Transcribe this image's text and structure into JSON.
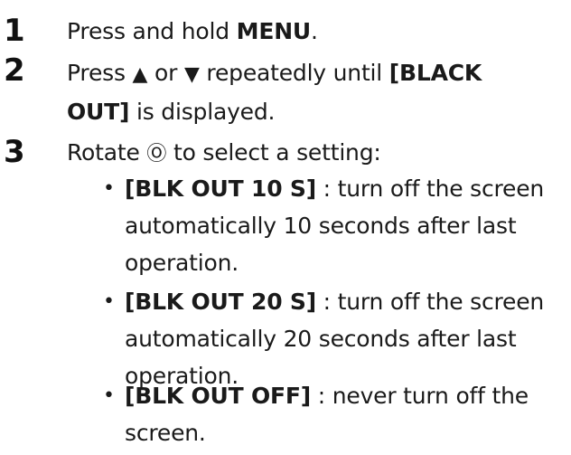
{
  "steps": [
    {
      "number": "1",
      "text_before": "Press and hold ",
      "bold": "MENU",
      "text_after": "."
    },
    {
      "number": "2",
      "line1_text": "Press ",
      "up_symbol": "▲",
      "or_text": " or ",
      "down_symbol": "▼",
      "line1_rest": " repeatedly until ",
      "bold_part1": "[BLACK",
      "bold_part2": "OUT]",
      "line2_rest": " is displayed."
    },
    {
      "number": "3",
      "text_before": "Rotate ",
      "knob_symbol": "Ⓞ",
      "text_after": " to select a setting:"
    }
  ],
  "bullets": [
    {
      "marker": "•",
      "label": "[BLK OUT 10 S]",
      "line1": " : turn off the screen",
      "line2": "automatically 10 seconds after last",
      "line3": "operation."
    },
    {
      "marker": "•",
      "label": "[BLK OUT 20 S]",
      "line1": " : turn off the screen",
      "line2": "automatically 20 seconds after last",
      "line3": "operation."
    },
    {
      "marker": "•",
      "label": "[BLK OUT OFF]",
      "line1": " : never turn off the",
      "line2": "screen."
    }
  ]
}
